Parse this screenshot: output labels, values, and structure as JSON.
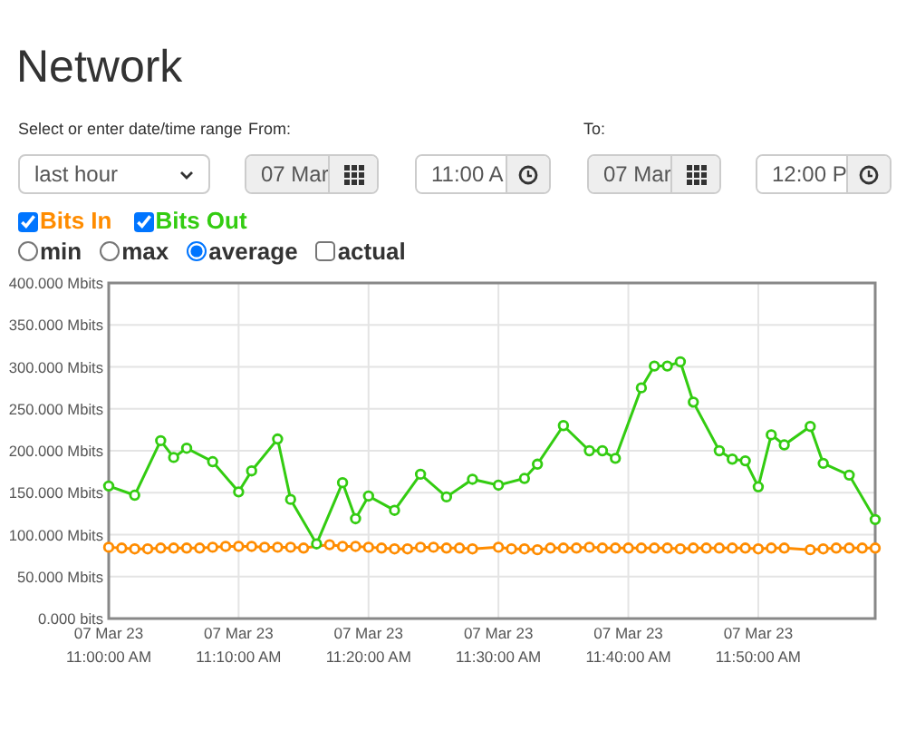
{
  "title": "Network",
  "range": {
    "label": "Select or enter date/time range",
    "value": "last hour"
  },
  "from": {
    "label": "From:",
    "date": "07 Mar",
    "time": "11:00 A"
  },
  "to": {
    "label": "To:",
    "date": "07 Mar",
    "time": "12:00 P"
  },
  "series_toggles": [
    {
      "checked": true
    },
    {
      "checked": true
    }
  ],
  "aggregation": [
    {
      "label": "min",
      "selected": false
    },
    {
      "label": "max",
      "selected": false
    },
    {
      "label": "average",
      "selected": true
    }
  ],
  "actual": {
    "label": "actual",
    "checked": false
  },
  "chart": {
    "chart_data": {
      "type": "line",
      "ylim": [
        0,
        400
      ],
      "grid": true,
      "categories": [
        "07 Mar 23\n11:00:00 AM",
        null,
        null,
        null,
        null,
        null,
        null,
        null,
        null,
        null,
        "07 Mar 23\n11:10:00 AM",
        null,
        null,
        null,
        null,
        null,
        null,
        null,
        null,
        null,
        "07 Mar 23\n11:20:00 AM",
        null,
        null,
        null,
        null,
        null,
        null,
        null,
        null,
        null,
        "07 Mar 23\n11:30:00 AM",
        null,
        null,
        null,
        null,
        null,
        null,
        null,
        null,
        null,
        "07 Mar 23\n11:40:00 AM",
        null,
        null,
        null,
        null,
        null,
        null,
        null,
        null,
        null,
        "07 Mar 23\n11:50:00 AM",
        null,
        null,
        null,
        null,
        null,
        null,
        null,
        null,
        null
      ],
      "yticks": [
        {
          "value": 0,
          "label": "0.000 bits"
        },
        {
          "value": 50,
          "label": "50.000 Mbits"
        },
        {
          "value": 100,
          "label": "100.000 Mbits"
        },
        {
          "value": 150,
          "label": "150.000 Mbits"
        },
        {
          "value": 200,
          "label": "200.000 Mbits"
        },
        {
          "value": 250,
          "label": "250.000 Mbits"
        },
        {
          "value": 300,
          "label": "300.000 Mbits"
        },
        {
          "value": 350,
          "label": "350.000 Mbits"
        },
        {
          "value": 400,
          "label": "400.000 Mbits"
        }
      ],
      "series": [
        {
          "name": "Bits In",
          "color": "#ff8c00",
          "marker": "circle",
          "values": [
            85,
            84,
            83,
            83,
            84,
            84,
            84,
            84,
            85,
            86,
            86,
            86,
            85,
            85,
            85,
            84,
            null,
            88,
            86,
            86,
            85,
            84,
            83,
            83,
            85,
            85,
            84,
            84,
            83,
            null,
            85,
            83,
            83,
            82,
            84,
            84,
            84,
            85,
            84,
            84,
            84,
            84,
            84,
            84,
            83,
            84,
            84,
            84,
            84,
            84,
            83,
            84,
            84,
            null,
            82,
            83,
            84,
            84,
            84,
            84
          ]
        },
        {
          "name": "Bits Out",
          "color": "#33cc11",
          "marker": "circle",
          "values": [
            158,
            null,
            147,
            null,
            212,
            192,
            203,
            null,
            187,
            null,
            151,
            176,
            null,
            214,
            142,
            null,
            89,
            null,
            162,
            119,
            146,
            null,
            129,
            null,
            172,
            null,
            145,
            null,
            166,
            null,
            159,
            null,
            167,
            184,
            null,
            230,
            null,
            200,
            200,
            191,
            null,
            275,
            301,
            301,
            306,
            258,
            null,
            200,
            190,
            188,
            157,
            219,
            207,
            null,
            229,
            185,
            null,
            171,
            null,
            118
          ]
        }
      ]
    }
  }
}
